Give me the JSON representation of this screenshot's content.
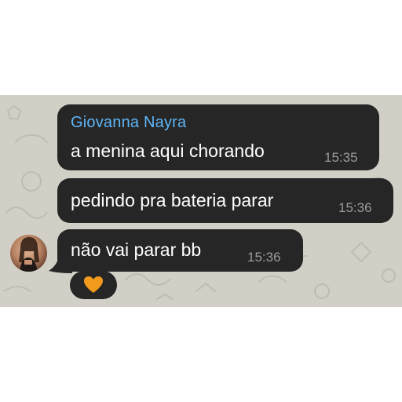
{
  "messages": [
    {
      "sender": "Giovanna Nayra",
      "text": "a menina aqui chorando",
      "time": "15:35"
    },
    {
      "text": "pedindo pra bateria parar",
      "time": "15:36"
    },
    {
      "text": "não vai parar bb",
      "time": "15:36"
    }
  ],
  "reaction": {
    "emoji": "orange-heart-icon"
  },
  "colors": {
    "chat_background": "#d2d0c6",
    "bubble": "#262626",
    "sender_name": "#5eb5f7",
    "message_text": "#ffffff",
    "timestamp": "#9a9a9a",
    "reaction_heart": "#f29a1c"
  }
}
